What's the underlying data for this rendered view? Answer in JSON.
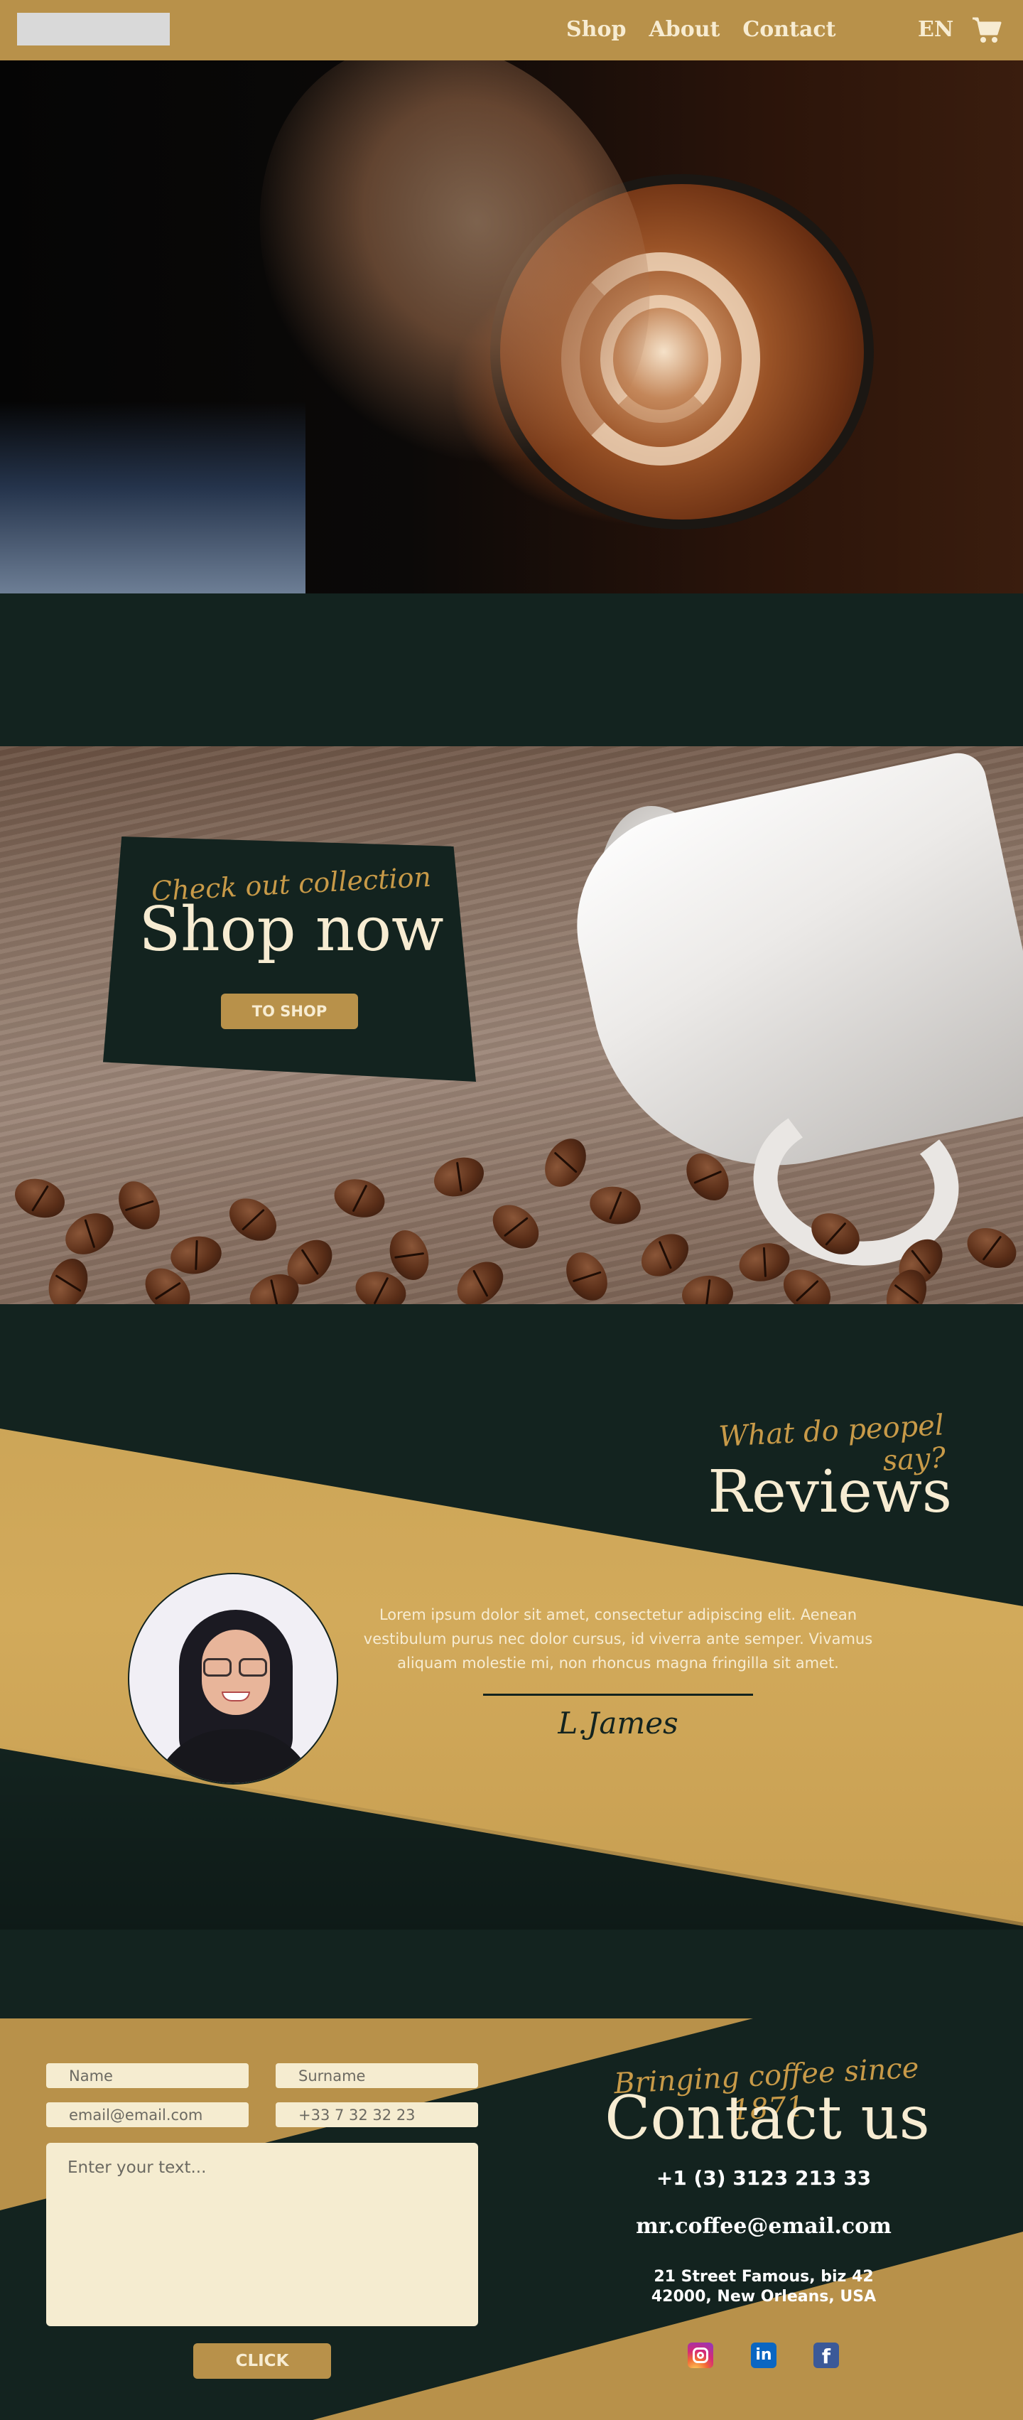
{
  "header": {
    "nav": [
      {
        "label": "Shop"
      },
      {
        "label": "About"
      },
      {
        "label": "Contact"
      }
    ],
    "language": "EN",
    "logo_icon": "logo-placeholder",
    "cart_icon": "cart-icon"
  },
  "shop": {
    "kicker": "Check out collection",
    "title": "Shop now",
    "button_label": "TO SHOP"
  },
  "reviews": {
    "kicker": "What do peopel say?",
    "title": "Reviews",
    "text": "Lorem ipsum dolor sit amet, consectetur adipiscing elit. Aenean vestibulum purus nec dolor cursus, id viverra ante semper. Vivamus aliquam molestie mi, non rhoncus magna fringilla sit amet.",
    "author": "L.James"
  },
  "contact": {
    "form": {
      "name_placeholder": "Name",
      "surname_placeholder": "Surname",
      "email_placeholder": "email@email.com",
      "phone_placeholder": "+33 7 32 32 23",
      "message_placeholder": "Enter your text...",
      "submit_label": "CLICK"
    },
    "kicker": "Bringing coffee since 1871",
    "title": "Contact us",
    "phone": "+1 (3) 3123 213 33",
    "email": "mr.coffee@email.com",
    "address": "21 Street Famous, biz 42 42000, New Orleans, USA",
    "social": [
      {
        "icon": "instagram-icon"
      },
      {
        "icon": "linkedin-icon",
        "glyph": "in"
      },
      {
        "icon": "facebook-icon",
        "glyph": "f"
      }
    ]
  },
  "colors": {
    "dark_green": "#13231f",
    "gold": "#b8914a",
    "cream": "#f7ecd2",
    "input_bg": "#f5ecd0"
  }
}
